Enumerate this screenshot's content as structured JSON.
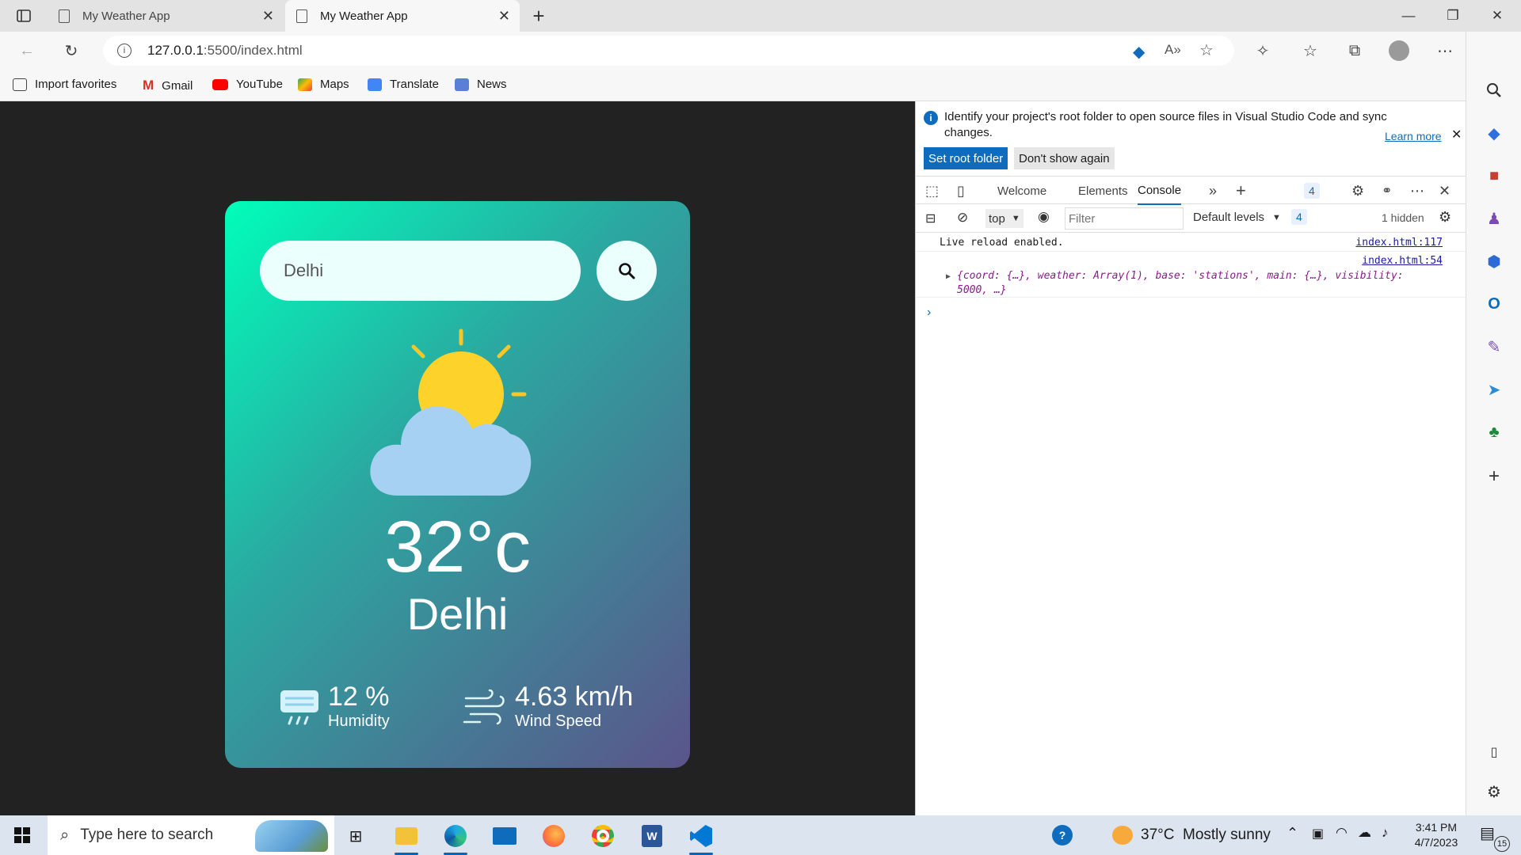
{
  "browser": {
    "tabs": [
      {
        "title": "My Weather App",
        "active": false
      },
      {
        "title": "My Weather App",
        "active": true
      }
    ],
    "address": "127.0.0.1:5500/index.html",
    "address_host": "127.0.0.1",
    "address_path": ":5500/index.html",
    "bookmarks": [
      "Import favorites",
      "Gmail",
      "YouTube",
      "Maps",
      "Translate",
      "News"
    ]
  },
  "app": {
    "search_value": "Delhi",
    "temperature": "32°c",
    "city": "Delhi",
    "humidity_value": "12 %",
    "humidity_label": "Humidity",
    "wind_value": "4.63 km/h",
    "wind_label": "Wind Speed"
  },
  "devtools": {
    "info_text": "Identify your project's root folder to open source files in Visual Studio Code and sync changes.",
    "learn_more": "Learn more",
    "set_root": "Set root folder",
    "dont_show": "Don't show again",
    "tabs": [
      "Welcome",
      "Elements",
      "Console"
    ],
    "issues_count": "4",
    "context": "top",
    "filter_placeholder": "Filter",
    "levels": "Default levels",
    "hidden": "1 hidden",
    "logs": [
      {
        "text": "Live reload enabled.",
        "source": "index.html:117"
      },
      {
        "text": "{coord: {…}, weather: Array(1), base: 'stations', main: {…}, visibility: 5000, …}",
        "source": "index.html:54"
      }
    ]
  },
  "taskbar": {
    "search_placeholder": "Type here to search",
    "weather": "37°C  Mostly sunny",
    "time": "3:41 PM",
    "date": "4/7/2023",
    "notifications": "15"
  },
  "colors": {
    "card_start": "#00feba",
    "card_end": "#5b548a",
    "accent": "#0f6cbd"
  }
}
